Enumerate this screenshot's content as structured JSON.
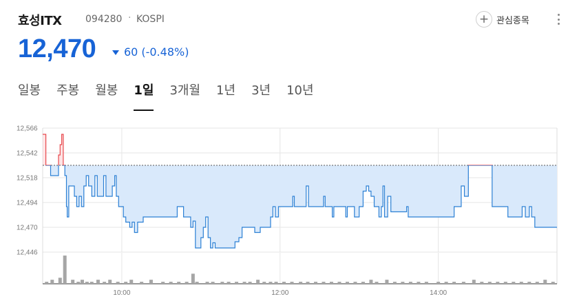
{
  "stock": {
    "name": "효성ITX",
    "code": "094280",
    "separator": "·",
    "market": "KOSPI"
  },
  "price": {
    "current": "12,470",
    "change": "60",
    "change_pct": "(-0.48%)",
    "color": "#1763d6"
  },
  "watchlist": {
    "label": "관심종목",
    "icon": "plus-icon"
  },
  "tabs": [
    {
      "label": "일봉",
      "active": false
    },
    {
      "label": "주봉",
      "active": false
    },
    {
      "label": "월봉",
      "active": false
    },
    {
      "label": "1일",
      "active": true
    },
    {
      "label": "3개월",
      "active": false
    },
    {
      "label": "1년",
      "active": false
    },
    {
      "label": "3년",
      "active": false
    },
    {
      "label": "10년",
      "active": false
    }
  ],
  "chart_data": {
    "type": "area",
    "ylim": [
      12446,
      12566
    ],
    "yticks": [
      "12,566",
      "12,542",
      "12,518",
      "12,494",
      "12,470",
      "12,446"
    ],
    "xticks": [
      {
        "label": "10:00",
        "t": 10.0
      },
      {
        "label": "12:00",
        "t": 12.0
      },
      {
        "label": "14:00",
        "t": 14.0
      }
    ],
    "session_start": 9.0,
    "session_end": 15.5,
    "previous_close": 12530,
    "colors": {
      "up": "#e8484d",
      "down": "#2a7fd4",
      "fill": "#d9e9fb",
      "volume": "#a6a6a6"
    },
    "price": [
      [
        9.0,
        12560
      ],
      [
        9.03,
        12560
      ],
      [
        9.04,
        12530
      ],
      [
        9.1,
        12520
      ],
      [
        9.18,
        12520
      ],
      [
        9.2,
        12540
      ],
      [
        9.22,
        12550
      ],
      [
        9.24,
        12560
      ],
      [
        9.26,
        12530
      ],
      [
        9.28,
        12520
      ],
      [
        9.3,
        12490
      ],
      [
        9.31,
        12480
      ],
      [
        9.33,
        12510
      ],
      [
        9.38,
        12510
      ],
      [
        9.4,
        12500
      ],
      [
        9.43,
        12490
      ],
      [
        9.46,
        12500
      ],
      [
        9.49,
        12490
      ],
      [
        9.52,
        12510
      ],
      [
        9.55,
        12520
      ],
      [
        9.58,
        12510
      ],
      [
        9.62,
        12500
      ],
      [
        9.66,
        12520
      ],
      [
        9.69,
        12500
      ],
      [
        9.74,
        12500
      ],
      [
        9.77,
        12520
      ],
      [
        9.8,
        12500
      ],
      [
        9.84,
        12500
      ],
      [
        9.88,
        12510
      ],
      [
        9.91,
        12520
      ],
      [
        9.93,
        12500
      ],
      [
        9.96,
        12490
      ],
      [
        10.02,
        12480
      ],
      [
        10.05,
        12475
      ],
      [
        10.1,
        12470
      ],
      [
        10.13,
        12475
      ],
      [
        10.16,
        12465
      ],
      [
        10.2,
        12475
      ],
      [
        10.27,
        12480
      ],
      [
        10.4,
        12480
      ],
      [
        10.5,
        12480
      ],
      [
        10.65,
        12480
      ],
      [
        10.7,
        12490
      ],
      [
        10.76,
        12490
      ],
      [
        10.78,
        12480
      ],
      [
        10.84,
        12480
      ],
      [
        10.87,
        12470
      ],
      [
        10.9,
        12476
      ],
      [
        10.93,
        12450
      ],
      [
        10.98,
        12450
      ],
      [
        11.0,
        12460
      ],
      [
        11.03,
        12470
      ],
      [
        11.06,
        12480
      ],
      [
        11.09,
        12460
      ],
      [
        11.12,
        12450
      ],
      [
        11.15,
        12455
      ],
      [
        11.18,
        12450
      ],
      [
        11.4,
        12450
      ],
      [
        11.43,
        12456
      ],
      [
        11.48,
        12460
      ],
      [
        11.52,
        12470
      ],
      [
        11.58,
        12470
      ],
      [
        11.64,
        12470
      ],
      [
        11.68,
        12465
      ],
      [
        11.75,
        12470
      ],
      [
        11.8,
        12470
      ],
      [
        11.85,
        12470
      ],
      [
        11.88,
        12480
      ],
      [
        11.91,
        12490
      ],
      [
        11.94,
        12480
      ],
      [
        11.98,
        12490
      ],
      [
        12.03,
        12490
      ],
      [
        12.1,
        12490
      ],
      [
        12.16,
        12500
      ],
      [
        12.18,
        12490
      ],
      [
        12.3,
        12490
      ],
      [
        12.33,
        12510
      ],
      [
        12.36,
        12490
      ],
      [
        12.45,
        12490
      ],
      [
        12.55,
        12500
      ],
      [
        12.57,
        12490
      ],
      [
        12.63,
        12490
      ],
      [
        12.66,
        12480
      ],
      [
        12.68,
        12490
      ],
      [
        12.8,
        12490
      ],
      [
        12.83,
        12480
      ],
      [
        12.85,
        12490
      ],
      [
        12.91,
        12490
      ],
      [
        12.94,
        12480
      ],
      [
        13.0,
        12490
      ],
      [
        13.05,
        12505
      ],
      [
        13.09,
        12510
      ],
      [
        13.12,
        12505
      ],
      [
        13.15,
        12500
      ],
      [
        13.19,
        12490
      ],
      [
        13.25,
        12480
      ],
      [
        13.28,
        12490
      ],
      [
        13.3,
        12510
      ],
      [
        13.32,
        12480
      ],
      [
        13.36,
        12500
      ],
      [
        13.4,
        12485
      ],
      [
        13.46,
        12485
      ],
      [
        13.56,
        12485
      ],
      [
        13.6,
        12490
      ],
      [
        13.62,
        12480
      ],
      [
        13.8,
        12480
      ],
      [
        14.0,
        12480
      ],
      [
        14.17,
        12480
      ],
      [
        14.2,
        12490
      ],
      [
        14.26,
        12490
      ],
      [
        14.29,
        12510
      ],
      [
        14.33,
        12500
      ],
      [
        14.38,
        12530
      ],
      [
        14.47,
        12530
      ],
      [
        14.65,
        12530
      ],
      [
        14.68,
        12490
      ],
      [
        14.8,
        12490
      ],
      [
        14.88,
        12480
      ],
      [
        15.03,
        12480
      ],
      [
        15.06,
        12490
      ],
      [
        15.1,
        12480
      ],
      [
        15.15,
        12490
      ],
      [
        15.18,
        12480
      ],
      [
        15.22,
        12470
      ],
      [
        15.5,
        12470
      ]
    ],
    "volume": [
      [
        9.05,
        1
      ],
      [
        9.12,
        2
      ],
      [
        9.22,
        3
      ],
      [
        9.28,
        14
      ],
      [
        9.38,
        2
      ],
      [
        9.45,
        1
      ],
      [
        9.5,
        2
      ],
      [
        9.56,
        1
      ],
      [
        9.62,
        1
      ],
      [
        9.7,
        2
      ],
      [
        9.78,
        1
      ],
      [
        9.85,
        2
      ],
      [
        9.95,
        1
      ],
      [
        10.05,
        1
      ],
      [
        10.12,
        2
      ],
      [
        10.25,
        1
      ],
      [
        10.37,
        2
      ],
      [
        10.52,
        1
      ],
      [
        10.62,
        1
      ],
      [
        10.72,
        1
      ],
      [
        10.82,
        1
      ],
      [
        10.9,
        5
      ],
      [
        10.95,
        1
      ],
      [
        11.08,
        1
      ],
      [
        11.15,
        1
      ],
      [
        11.27,
        1
      ],
      [
        11.35,
        1
      ],
      [
        11.45,
        1
      ],
      [
        11.55,
        1
      ],
      [
        11.62,
        1
      ],
      [
        11.72,
        2
      ],
      [
        11.8,
        1
      ],
      [
        11.88,
        1
      ],
      [
        11.95,
        1
      ],
      [
        12.05,
        1
      ],
      [
        12.15,
        1
      ],
      [
        12.26,
        1
      ],
      [
        12.35,
        1
      ],
      [
        12.45,
        1
      ],
      [
        12.55,
        1
      ],
      [
        12.65,
        1
      ],
      [
        12.75,
        1
      ],
      [
        12.85,
        1
      ],
      [
        12.95,
        1
      ],
      [
        13.05,
        1
      ],
      [
        13.15,
        2
      ],
      [
        13.22,
        1
      ],
      [
        13.35,
        2
      ],
      [
        13.45,
        1
      ],
      [
        13.55,
        1
      ],
      [
        13.65,
        1
      ],
      [
        13.75,
        1
      ],
      [
        13.85,
        1
      ],
      [
        14.0,
        1
      ],
      [
        14.1,
        1
      ],
      [
        14.2,
        1
      ],
      [
        14.32,
        1
      ],
      [
        14.45,
        2
      ],
      [
        14.55,
        1
      ],
      [
        14.65,
        1
      ],
      [
        14.75,
        1
      ],
      [
        14.85,
        1
      ],
      [
        14.95,
        1
      ],
      [
        15.05,
        1
      ],
      [
        15.15,
        1
      ],
      [
        15.25,
        1
      ],
      [
        15.35,
        2
      ],
      [
        15.45,
        1
      ]
    ]
  }
}
